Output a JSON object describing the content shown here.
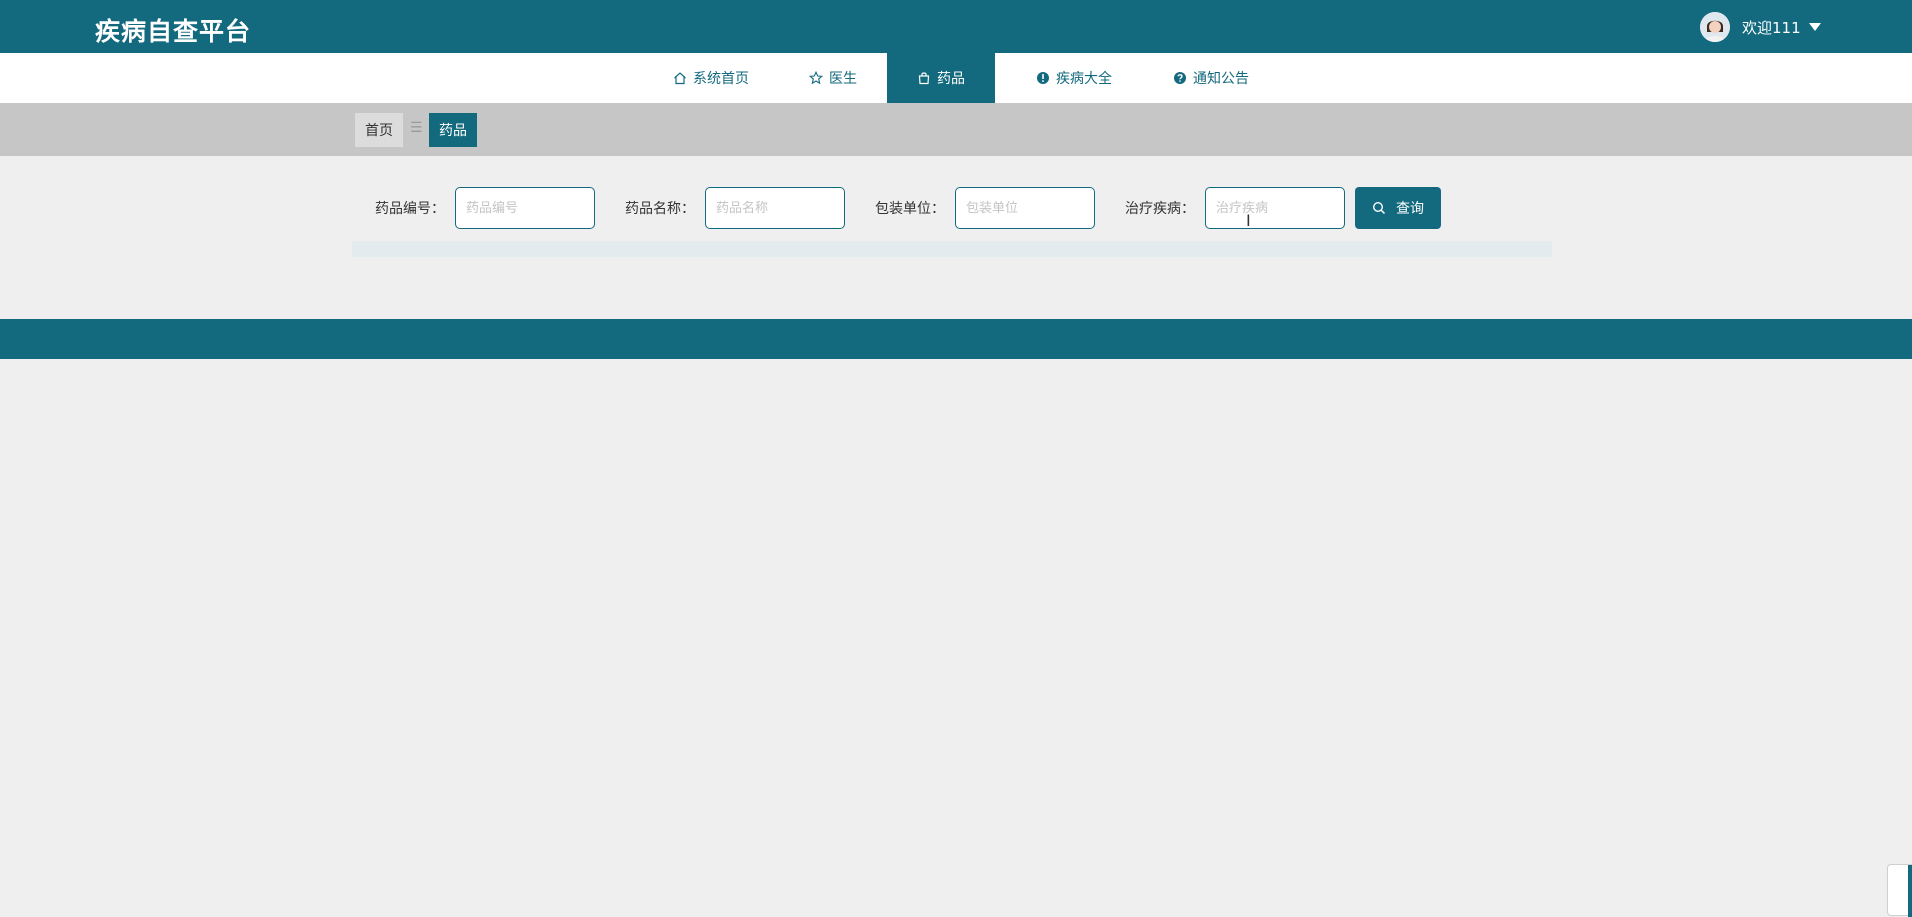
{
  "header": {
    "title": "疾病自查平台",
    "welcome": "欢迎111",
    "avatar_icon": "user-avatar",
    "dropdown_icon": "caret-down-icon"
  },
  "nav": {
    "items": [
      {
        "label": "系统首页",
        "icon": "home-icon",
        "active": false
      },
      {
        "label": "医生",
        "icon": "star-icon",
        "active": false
      },
      {
        "label": "药品",
        "icon": "bag-icon",
        "active": true
      },
      {
        "label": "疾病大全",
        "icon": "exclamation-circle-icon",
        "active": false
      },
      {
        "label": "通知公告",
        "icon": "question-circle-icon",
        "active": false
      }
    ]
  },
  "breadcrumb": {
    "home": "首页",
    "separator": "☰",
    "current": "药品"
  },
  "search": {
    "fields": [
      {
        "label": "药品编号：",
        "placeholder": "药品编号",
        "value": ""
      },
      {
        "label": "药品名称：",
        "placeholder": "药品名称",
        "value": ""
      },
      {
        "label": "包装单位：",
        "placeholder": "包装单位",
        "value": ""
      },
      {
        "label": "治疗疾病：",
        "placeholder": "治疗疾病",
        "value": ""
      }
    ],
    "button_label": "查询",
    "button_icon": "search-icon"
  },
  "colors": {
    "primary": "#13697e",
    "page_bg": "#efefef",
    "breadcrumb_bg": "#c6c6c6"
  }
}
